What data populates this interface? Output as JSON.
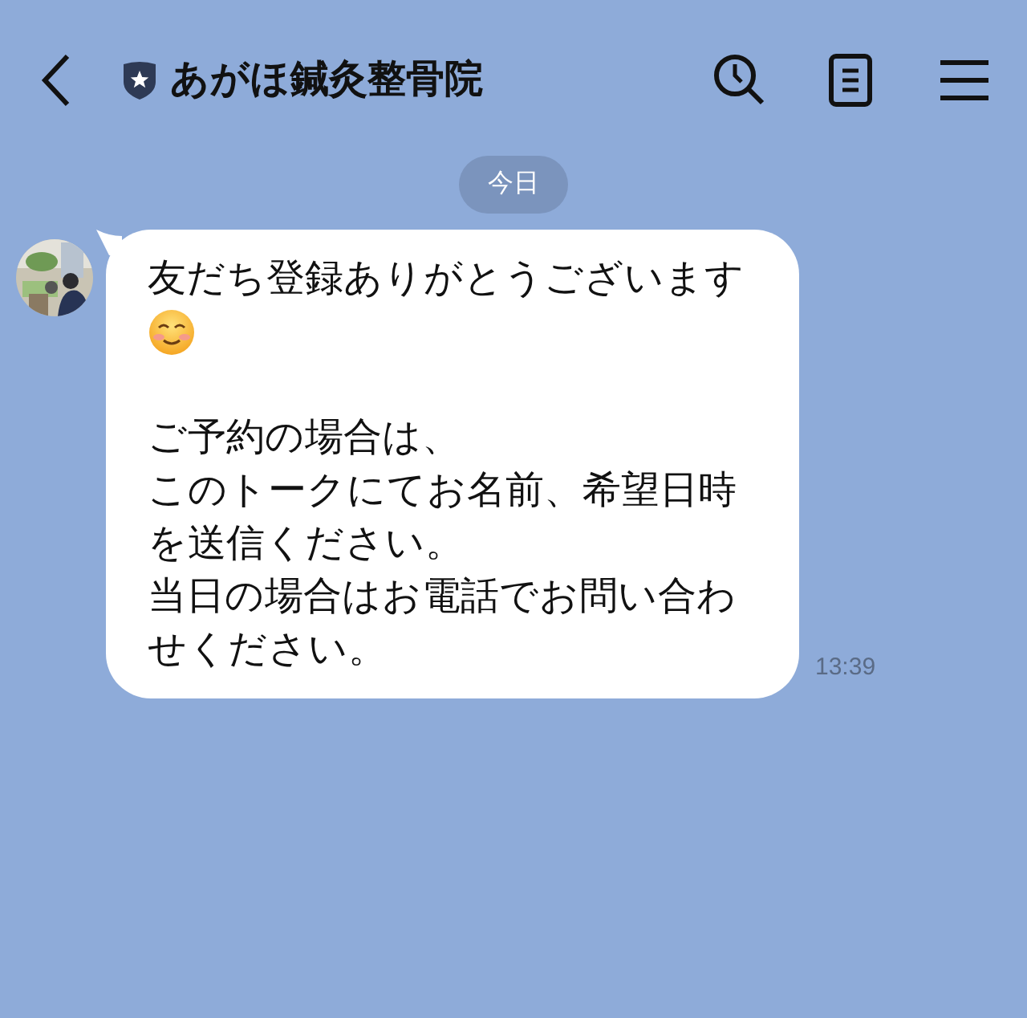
{
  "header": {
    "title": "あがほ鍼灸整骨院"
  },
  "date_label": "今日",
  "message": {
    "time": "13:39",
    "content": [
      {
        "kind": "text",
        "text": "友だち登録ありがとうございます"
      },
      {
        "kind": "emoji"
      },
      {
        "kind": "blank_line"
      },
      {
        "kind": "text",
        "text": "ご予約の場合は、"
      },
      {
        "kind": "text",
        "text": "このトークにてお名前、希望日時を送信ください。"
      },
      {
        "kind": "text",
        "text": "当日の場合はお電話でお問い合わせください。"
      }
    ]
  }
}
